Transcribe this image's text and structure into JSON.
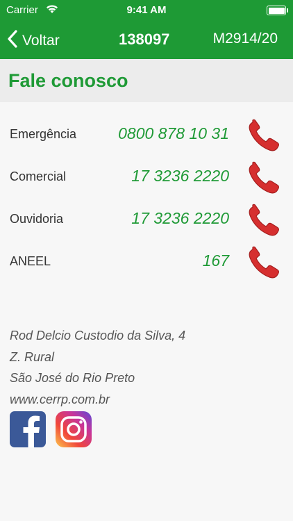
{
  "status_bar": {
    "carrier": "Carrier",
    "time": "9:41 AM"
  },
  "nav": {
    "back_label": "Voltar",
    "center_code": "138097",
    "right_code": "M2914/20"
  },
  "section": {
    "title": "Fale conosco"
  },
  "contacts": [
    {
      "label": "Emergência",
      "number": "0800 878 10 31"
    },
    {
      "label": "Comercial",
      "number": "17 3236 2220"
    },
    {
      "label": "Ouvidoria",
      "number": "17 3236 2220"
    },
    {
      "label": "ANEEL",
      "number": "167"
    }
  ],
  "address": {
    "line1": "Rod Delcio Custodio da Silva, 4",
    "line2": "Z. Rural",
    "line3": "São José do Rio Preto",
    "website": "www.cerrp.com.br"
  },
  "colors": {
    "brand_green": "#1e9a35",
    "phone_red": "#d62f2f",
    "facebook_blue": "#3b5998"
  },
  "icons": [
    "wifi-icon",
    "battery-icon",
    "chevron-left-icon",
    "phone-icon",
    "facebook-icon",
    "instagram-icon"
  ]
}
